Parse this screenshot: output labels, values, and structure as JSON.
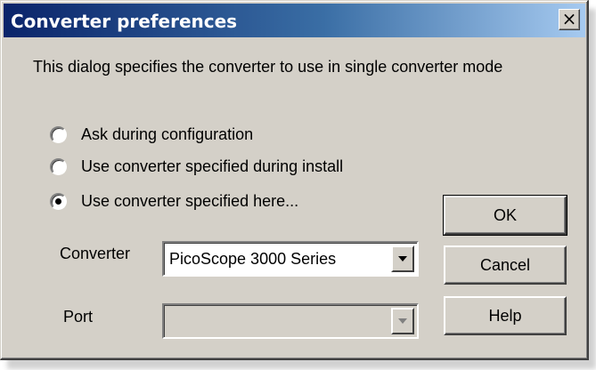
{
  "window": {
    "title": "Converter preferences",
    "close_glyph": "×"
  },
  "description": "This dialog specifies the converter to use in single converter mode",
  "options": [
    {
      "label": "Ask during configuration",
      "checked": false
    },
    {
      "label": "Use converter specified during install",
      "checked": false
    },
    {
      "label": "Use converter specified here...",
      "checked": true
    }
  ],
  "converter": {
    "label": "Converter",
    "value": "PicoScope 3000 Series"
  },
  "port": {
    "label": "Port",
    "value": ""
  },
  "buttons": {
    "ok": "OK",
    "cancel": "Cancel",
    "help": "Help"
  },
  "colors": {
    "title_gradient_start": "#0a246a",
    "title_gradient_end": "#a6caf0",
    "face": "#d4d0c8"
  }
}
